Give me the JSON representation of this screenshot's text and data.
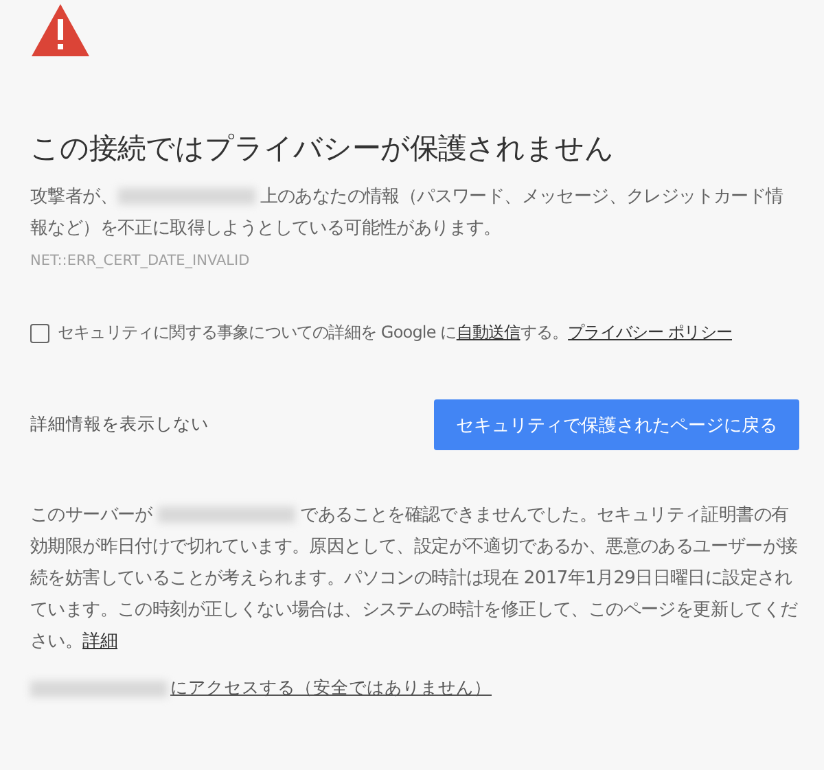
{
  "heading": "この接続ではプライバシーが保護されません",
  "intro": {
    "before": "攻撃者が、",
    "after": " 上のあなたの情報（パスワード、メッセージ、クレジットカード情報など）を不正に取得しようとしている可能性があります。"
  },
  "error_code": "NET::ERR_CERT_DATE_INVALID",
  "report": {
    "checked": false,
    "before": "セキュリティに関する事象についての詳細を Google に",
    "link": "自動送信",
    "after": "する。",
    "policy_link": "プライバシー ポリシー"
  },
  "details_toggle": "詳細情報を表示しない",
  "back_button": "セキュリティで保護されたページに戻る",
  "details": {
    "before": "このサーバーが ",
    "after": " であることを確認できませんでした。セキュリティ証明書の有効期限が昨日付けで切れています。原因として、設定が不適切であるか、悪意のあるユーザーが接続を妨害していることが考えられます。パソコンの時計は現在 2017年1月29日日曜日に設定されています。この時刻が正しくない場合は、システムの時計を修正して、このページを更新してください。",
    "link": "詳細"
  },
  "proceed_link": "にアクセスする（安全ではありません）"
}
